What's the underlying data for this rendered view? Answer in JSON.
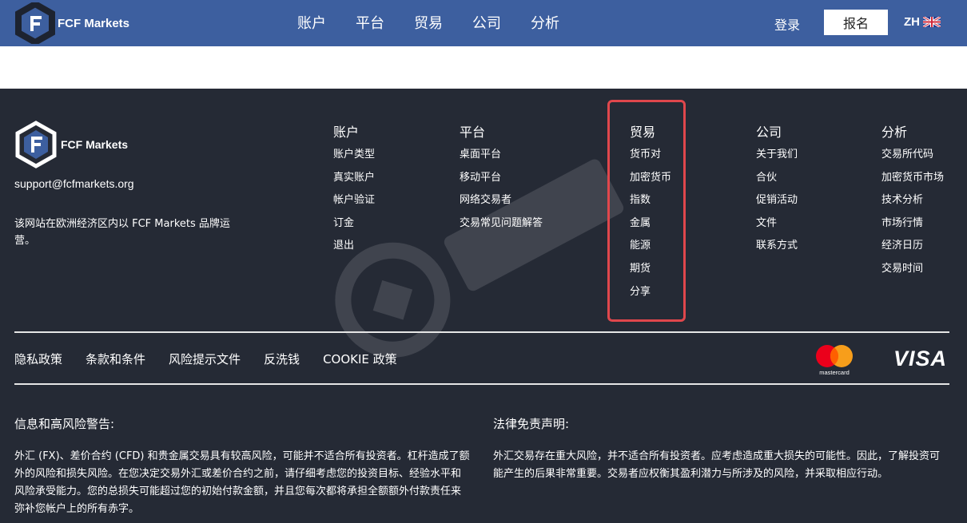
{
  "header": {
    "brand": "FCF Markets",
    "nav": [
      "账户",
      "平台",
      "贸易",
      "公司",
      "分析"
    ],
    "login": "登录",
    "signup": "报名",
    "lang": "ZH",
    "lang_flag_icon": "uk-flag-icon"
  },
  "footer": {
    "brand": "FCF Markets",
    "email": "support@fcfmarkets.org",
    "operated": "该网站在欧洲经济区内以 FCF Markets 品牌运营。",
    "columns": [
      {
        "title": "账户",
        "links": [
          "账户类型",
          "真实账户",
          "帐户验证",
          "订金",
          "退出"
        ]
      },
      {
        "title": "平台",
        "links": [
          "桌面平台",
          "移动平台",
          "网络交易者",
          "交易常见问题解答"
        ]
      },
      {
        "title": "贸易",
        "links": [
          "货币对",
          "加密货币",
          "指数",
          "金属",
          "能源",
          "期货",
          "分享"
        ]
      },
      {
        "title": "公司",
        "links": [
          "关于我们",
          "合伙",
          "促销活动",
          "文件",
          "联系方式"
        ]
      },
      {
        "title": "分析",
        "links": [
          "交易所代码",
          "加密货币市场",
          "技术分析",
          "市场行情",
          "经济日历",
          "交易时间"
        ]
      }
    ],
    "legal": [
      "隐私政策",
      "条款和条件",
      "风险提示文件",
      "反洗钱",
      "COOKIE 政策"
    ],
    "payment": {
      "mastercard": "mastercard",
      "visa": "VISA"
    },
    "warning": {
      "title": "信息和高风险警告:",
      "text": "外汇 (FX)、差价合约 (CFD) 和贵金属交易具有较高风险，可能并不适合所有投资者。杠杆造成了额外的风险和损失风险。在您决定交易外汇或差价合约之前，请仔细考虑您的投资目标、经验水平和风险承受能力。您的总损失可能超过您的初始付款金额，并且您每次都将承担全额额外付款责任来弥补您帐户上的所有赤字。"
    },
    "disclaimer": {
      "title": "法律免责声明:",
      "text": "外汇交易存在重大风险，并不适合所有投资者。应考虑造成重大损失的可能性。因此，了解投资可能产生的后果非常重要。交易者应权衡其盈利潜力与所涉及的风险，并采取相应行动。"
    }
  },
  "colors": {
    "nav_bg": "#3d5f9f",
    "footer_bg": "#252a35",
    "highlight": "#e0474c"
  }
}
